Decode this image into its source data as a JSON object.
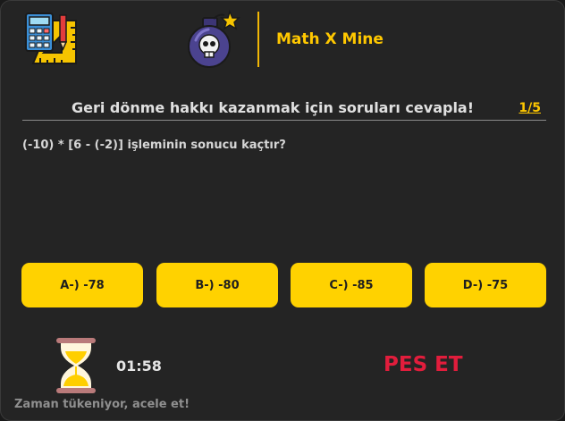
{
  "header": {
    "brand": "Math X Mine",
    "logo_icon": "math-tools-icon",
    "bomb_icon": "skull-bomb-icon"
  },
  "quiz": {
    "title": "Geri dönme hakkı kazanmak için soruları cevapla!",
    "counter": "1/5",
    "question": "(-10) * [6 - (-2)] işleminin sonucu kaçtır?",
    "answers": [
      "A-) -78",
      "B-) -80",
      "C-) -85",
      "D-) -75"
    ]
  },
  "footer": {
    "timer": "01:58",
    "give_up": "PES ET",
    "warning": "Zaman tükeniyor, acele et!",
    "hourglass_icon": "hourglass-icon"
  },
  "colors": {
    "accent": "#ffd200",
    "brand": "#ffc800",
    "danger": "#e11d3c",
    "background": "#242424"
  }
}
